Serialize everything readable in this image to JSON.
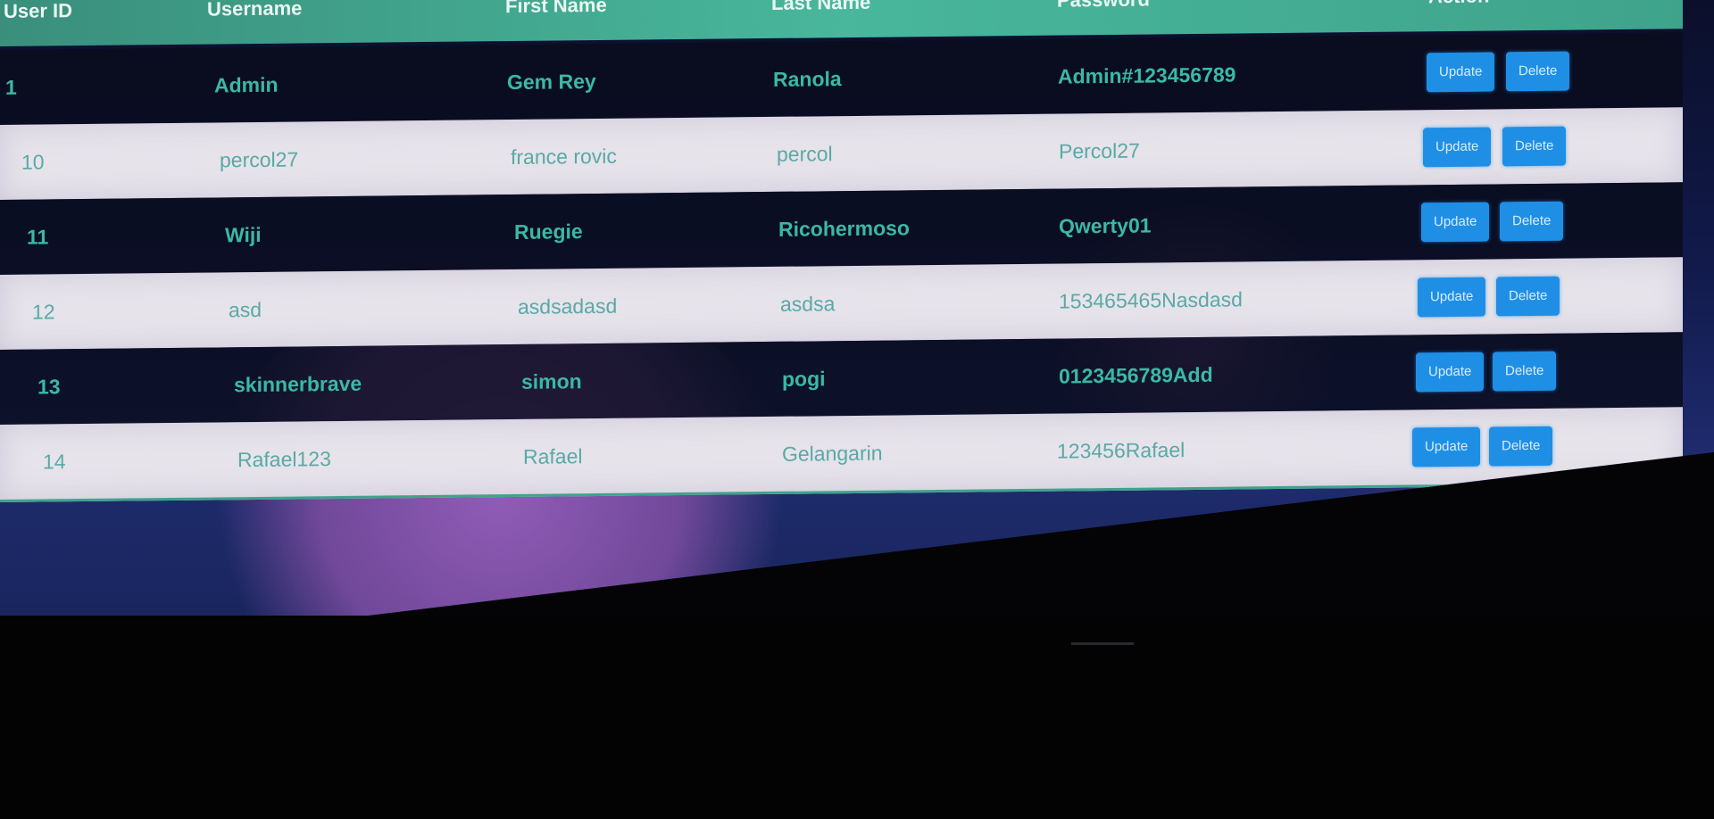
{
  "table": {
    "headers": [
      "User ID",
      "Username",
      "First Name",
      "Last Name",
      "Password",
      "Action"
    ],
    "rows": [
      {
        "id": "1",
        "username": "Admin",
        "first": "Gem Rey",
        "last": "Ranola",
        "password": "Admin#123456789"
      },
      {
        "id": "10",
        "username": "percol27",
        "first": "france rovic",
        "last": "percol",
        "password": "Percol27"
      },
      {
        "id": "11",
        "username": "Wiji",
        "first": "Ruegie",
        "last": "Ricohermoso",
        "password": "Qwerty01"
      },
      {
        "id": "12",
        "username": "asd",
        "first": "asdsadasd",
        "last": "asdsa",
        "password": "153465465Nasdasd"
      },
      {
        "id": "13",
        "username": "skinnerbrave",
        "first": "simon",
        "last": "pogi",
        "password": "0123456789Add"
      },
      {
        "id": "14",
        "username": "Rafael123",
        "first": "Rafael",
        "last": "Gelangarin",
        "password": "123456Rafael"
      }
    ],
    "update_label": "Update",
    "delete_label": "Delete"
  },
  "colors": {
    "header_bg": "#48b79c",
    "dark_row_text": "#3bb8a6",
    "light_row_bg": "#e6e3ea",
    "button_bg": "#1f8fe6"
  },
  "icons": {
    "cursor": "mouse-pointer-icon"
  }
}
